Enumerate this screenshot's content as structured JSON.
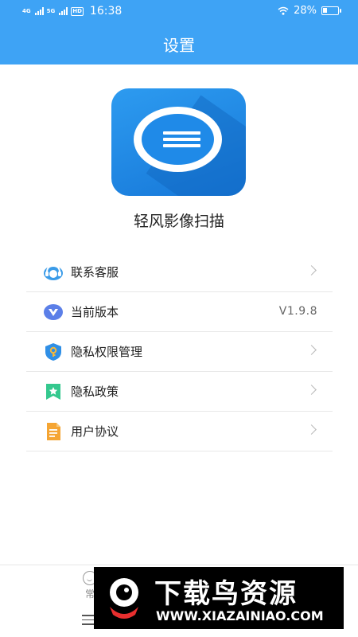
{
  "status_bar": {
    "net1": "4G",
    "net2": "5G",
    "hd": "HD",
    "time": "16:38",
    "battery_text": "28%",
    "battery_level": 0.28
  },
  "header": {
    "title": "设置"
  },
  "app": {
    "name": "轻风影像扫描"
  },
  "menu": [
    {
      "label": "联系客服",
      "icon": "headset-icon",
      "chevron": true
    },
    {
      "label": "当前版本",
      "icon": "version-icon",
      "value": "V1.9.8",
      "chevron": false
    },
    {
      "label": "隐私权限管理",
      "icon": "shield-key-icon",
      "chevron": true
    },
    {
      "label": "隐私政策",
      "icon": "policy-star-icon",
      "chevron": true
    },
    {
      "label": "用户协议",
      "icon": "document-icon",
      "chevron": true
    }
  ],
  "bottom_nav": {
    "item_label": "常"
  },
  "watermark": {
    "text": "下载鸟资源",
    "url": "WWW.XIAZAINIAO.COM"
  },
  "colors": {
    "header_bg": "#3ea3f5",
    "app_icon_bg": "#1f8ae8",
    "headset_icon": "#3a9be8",
    "version_icon": "#5b7fe8",
    "shield_icon": "#2f8fe6",
    "policy_icon": "#34c88e",
    "document_icon": "#f5a533"
  }
}
